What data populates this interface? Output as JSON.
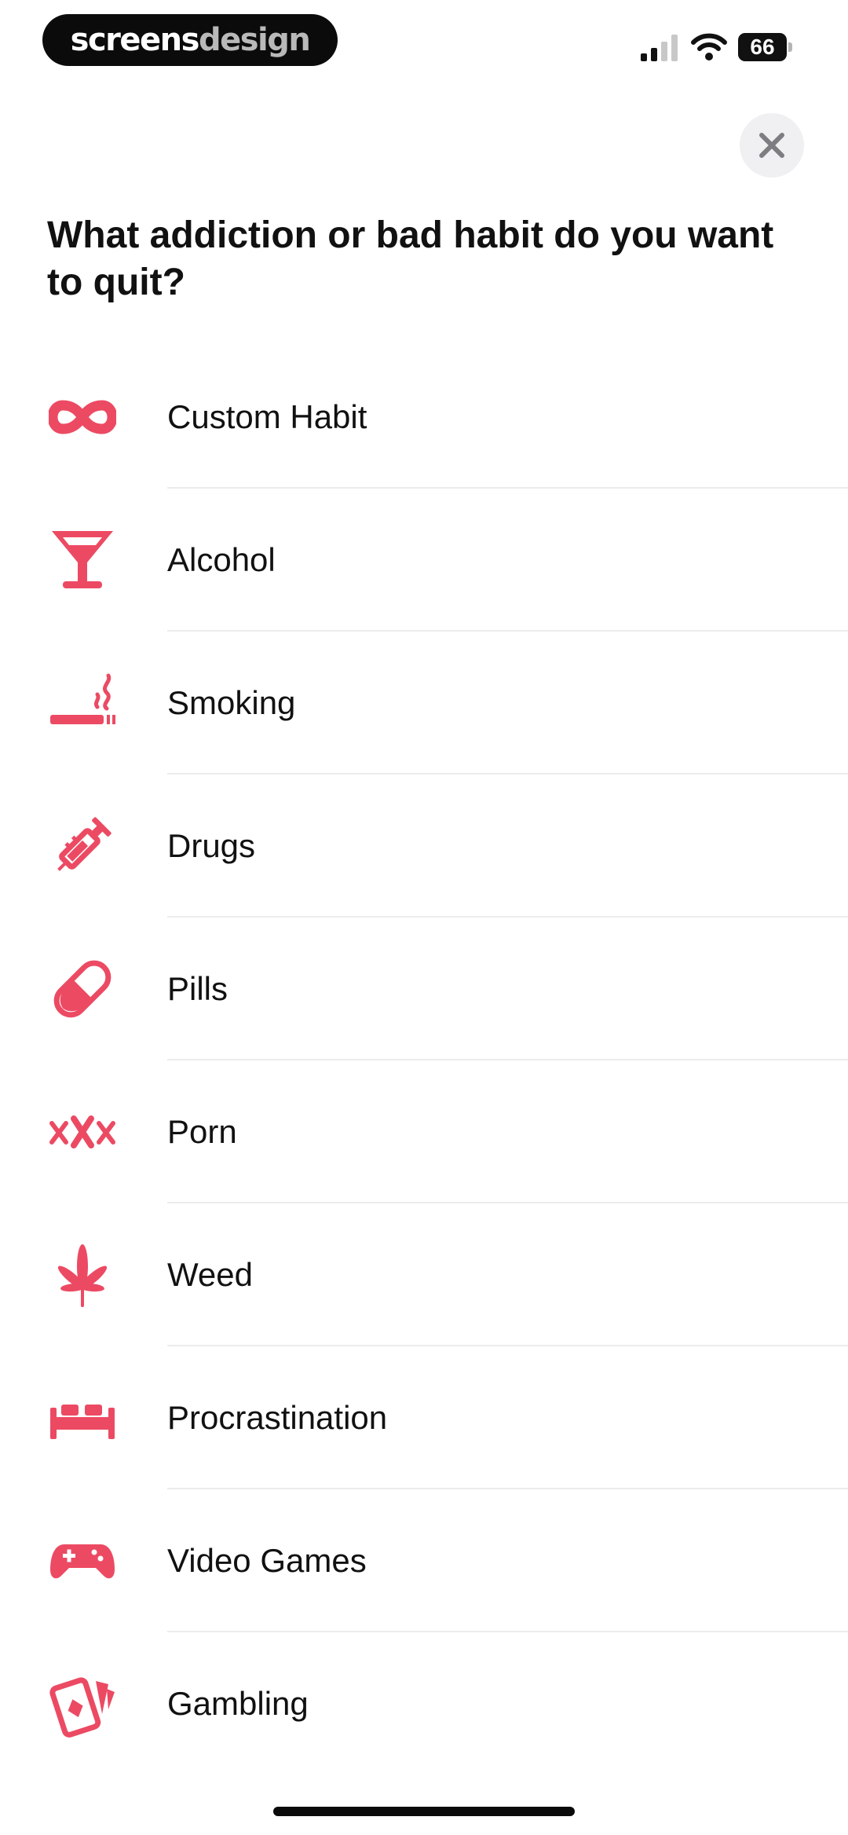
{
  "status_bar": {
    "brand_part1": "screens",
    "brand_part2": "design",
    "battery_level": "66"
  },
  "header": {
    "title": "What addiction or bad habit do you want to quit?",
    "close_icon": "close-icon"
  },
  "habits": [
    {
      "label": "Custom Habit",
      "icon": "infinity-icon"
    },
    {
      "label": "Alcohol",
      "icon": "cocktail-glass-icon"
    },
    {
      "label": "Smoking",
      "icon": "cigarette-icon"
    },
    {
      "label": "Drugs",
      "icon": "syringe-icon"
    },
    {
      "label": "Pills",
      "icon": "pill-icon"
    },
    {
      "label": "Porn",
      "icon": "xxx-icon"
    },
    {
      "label": "Weed",
      "icon": "cannabis-leaf-icon"
    },
    {
      "label": "Procrastination",
      "icon": "bed-icon"
    },
    {
      "label": "Video Games",
      "icon": "gamepad-icon"
    },
    {
      "label": "Gambling",
      "icon": "playing-cards-icon"
    }
  ],
  "colors": {
    "accent": "#ec4a63",
    "background": "#ffffff",
    "text": "#111111",
    "divider": "#ececec",
    "close_button_bg": "#f0f0f2"
  }
}
